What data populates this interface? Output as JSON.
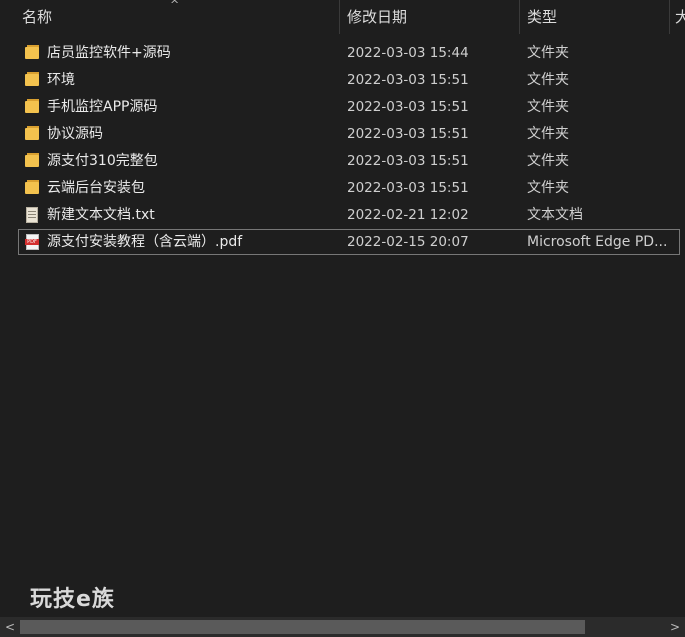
{
  "header": {
    "name_label": "名称",
    "date_label": "修改日期",
    "type_label": "类型",
    "size_label_partial": "大",
    "sort_arrow": "^"
  },
  "files": [
    {
      "name": "店员监控软件+源码",
      "date": "2022-03-03 15:44",
      "type": "文件夹",
      "icon": "folder-icon"
    },
    {
      "name": "环境",
      "date": "2022-03-03 15:51",
      "type": "文件夹",
      "icon": "folder-icon"
    },
    {
      "name": "手机监控APP源码",
      "date": "2022-03-03 15:51",
      "type": "文件夹",
      "icon": "folder-icon"
    },
    {
      "name": "协议源码",
      "date": "2022-03-03 15:51",
      "type": "文件夹",
      "icon": "folder-icon"
    },
    {
      "name": "源支付310完整包",
      "date": "2022-03-03 15:51",
      "type": "文件夹",
      "icon": "folder-icon"
    },
    {
      "name": "云端后台安装包",
      "date": "2022-03-03 15:51",
      "type": "文件夹",
      "icon": "folder-icon"
    },
    {
      "name": "新建文本文档.txt",
      "date": "2022-02-21 12:02",
      "type": "文本文档",
      "icon": "text-file-icon"
    },
    {
      "name": "源支付安装教程（含云端）.pdf",
      "date": "2022-02-15 20:07",
      "type": "Microsoft Edge PD...",
      "icon": "pdf-file-icon",
      "selected": true
    }
  ],
  "watermark": "玩技e族",
  "scrollbar": {
    "left_arrow": "<",
    "right_arrow": ">"
  },
  "colors": {
    "background": "#1e1e1e",
    "folder": "#f3c24e",
    "pdf_badge": "#d32f2f"
  },
  "pdf_badge_text": "PDF"
}
